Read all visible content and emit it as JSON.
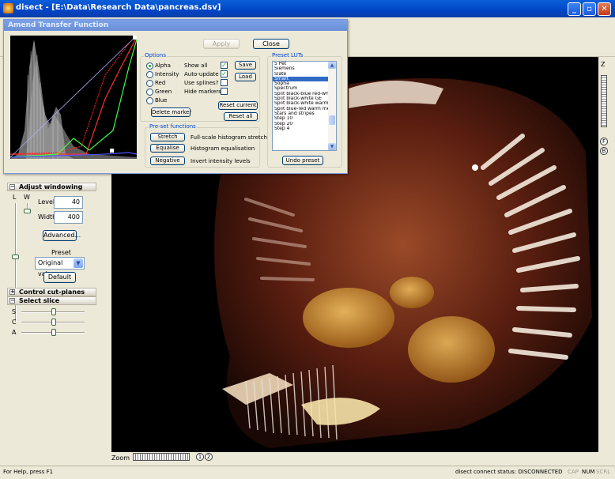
{
  "window": {
    "title": "disect - [E:\\Data\\Research Data\\pancreas.dsv]"
  },
  "dialog": {
    "title": "Amend Transfer Function",
    "apply_label": "Apply",
    "close_label": "Close",
    "options": {
      "title": "Options",
      "channels": [
        "Alpha",
        "Intensity",
        "Red",
        "Green",
        "Blue"
      ],
      "selected_channel": "Alpha",
      "show_all_label": "Show all",
      "show_all_checked": true,
      "auto_update_label": "Auto-update",
      "auto_update_checked": true,
      "use_splines_label": "Use splines?",
      "use_splines_checked": false,
      "hide_markers_label": "Hide markers",
      "hide_markers_checked": false,
      "save_label": "Save",
      "load_label": "Load",
      "delete_marker_label": "Delete marker",
      "reset_current_label": "Reset current",
      "reset_all_label": "Reset all"
    },
    "preset_functions": {
      "title": "Pre-set functions",
      "stretch_label": "Stretch",
      "stretch_desc": "Full-scale histogram stretch",
      "equalise_label": "Equalise",
      "equalise_desc": "Histogram equalisation",
      "negative_label": "Negative",
      "negative_desc": "Invert intensity levels"
    },
    "preset_luts": {
      "title": "Preset LUTs",
      "items": [
        "5 Pet",
        "Siemens",
        "Slate",
        "Smart",
        "Sopha",
        "Spectrum",
        "Split black-blue red-white",
        "Split black-white GE",
        "Split black-white warm m",
        "Split blue-red warm meta",
        "Stars and stripes",
        "Step 10",
        "Step 20",
        "Step 4"
      ],
      "selected": "Smart",
      "undo_label": "Undo preset"
    }
  },
  "left_panel": {
    "adjust_windowing": {
      "title": "Adjust windowing",
      "l_label": "L",
      "w_label": "W",
      "level_label": "Level",
      "level_value": "40",
      "width_label": "Width",
      "width_value": "400",
      "advanced_label": "Advanced...",
      "preset_label": "Preset",
      "preset_value": "Original values",
      "default_label": "Default"
    },
    "control_cut_planes": {
      "title": "Control cut-planes"
    },
    "select_slice": {
      "title": "Select slice",
      "axes": [
        "S",
        "C",
        "A"
      ]
    }
  },
  "right_panel": {
    "z_label": "Z",
    "f_label": "F",
    "b_label": "B"
  },
  "zoom": {
    "label": "Zoom",
    "btn1": "1",
    "btn2": "2"
  },
  "status_bar": {
    "help": "For Help, press F1",
    "connect_status": "disect connect status: DISCONNECTED",
    "cap": "CAP",
    "num": "NUM",
    "scrl": "SCRL"
  }
}
